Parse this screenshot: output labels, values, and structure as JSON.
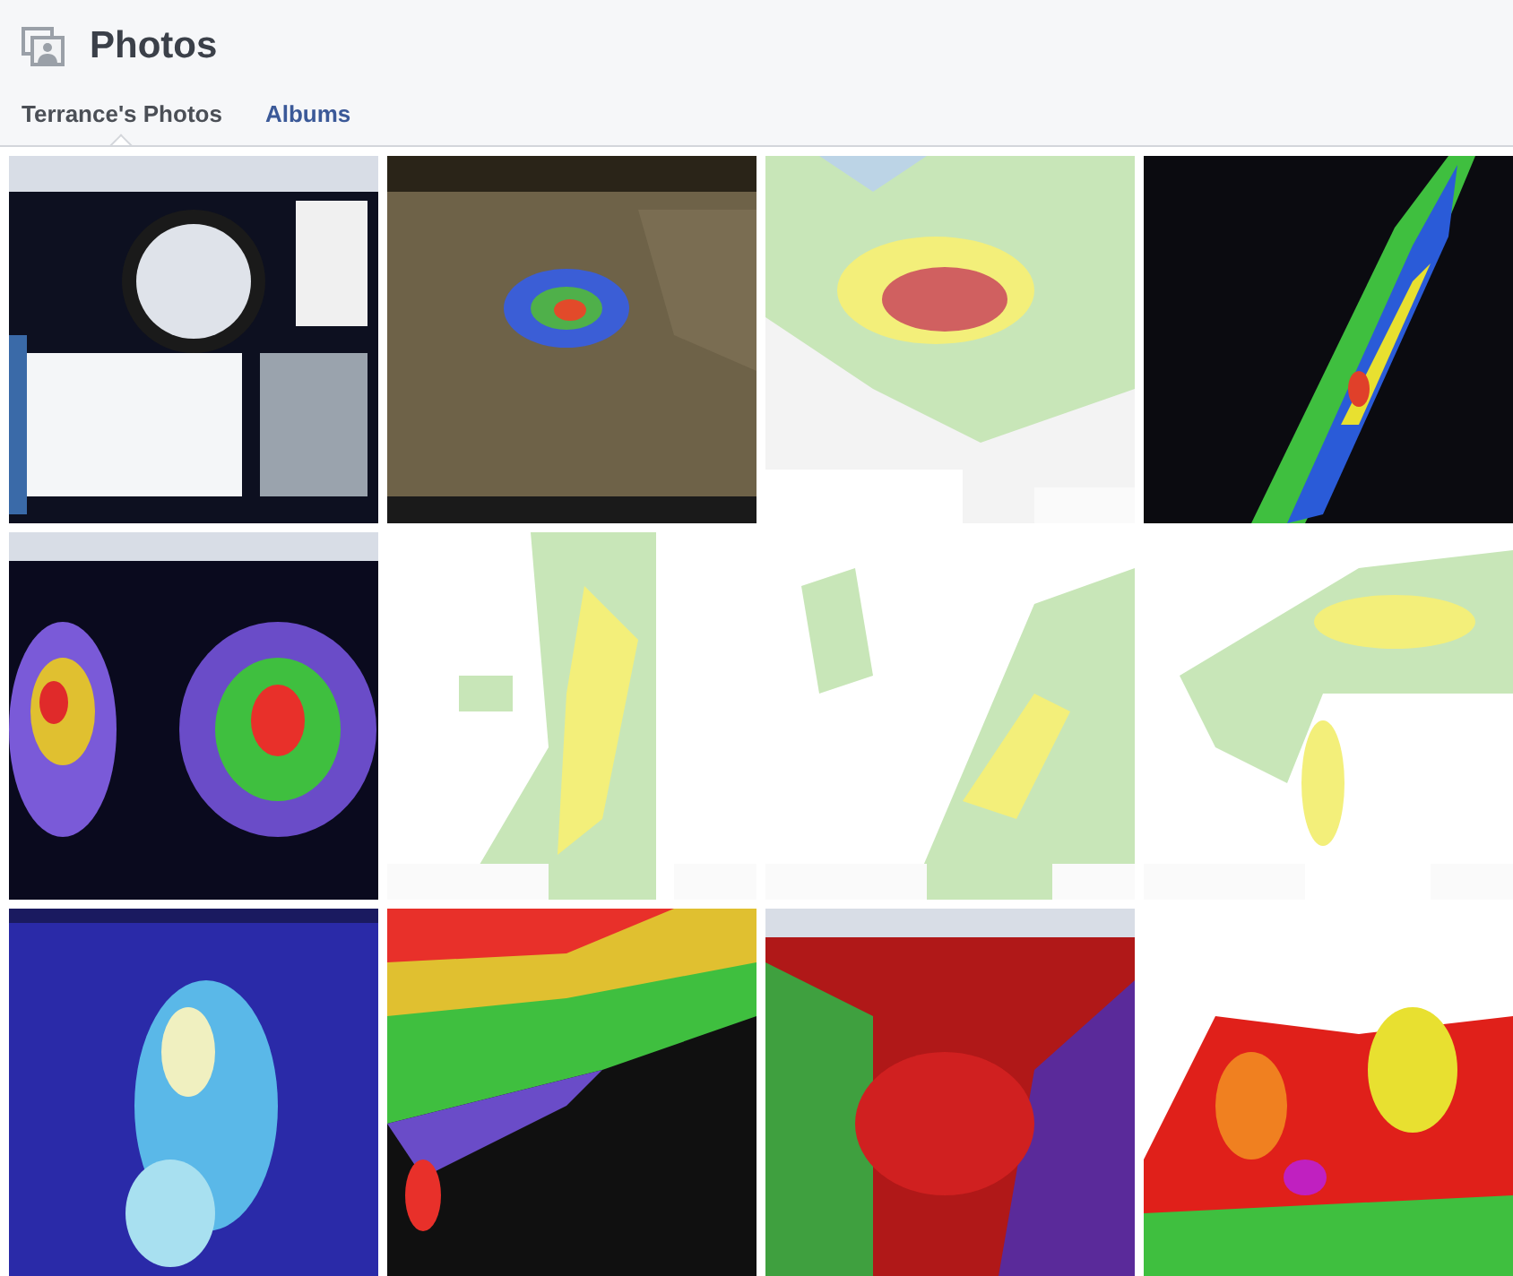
{
  "header": {
    "title": "Photos"
  },
  "tabs": [
    {
      "label": "Terrance's Photos",
      "selected": true
    },
    {
      "label": "Albums",
      "selected": false
    }
  ]
}
